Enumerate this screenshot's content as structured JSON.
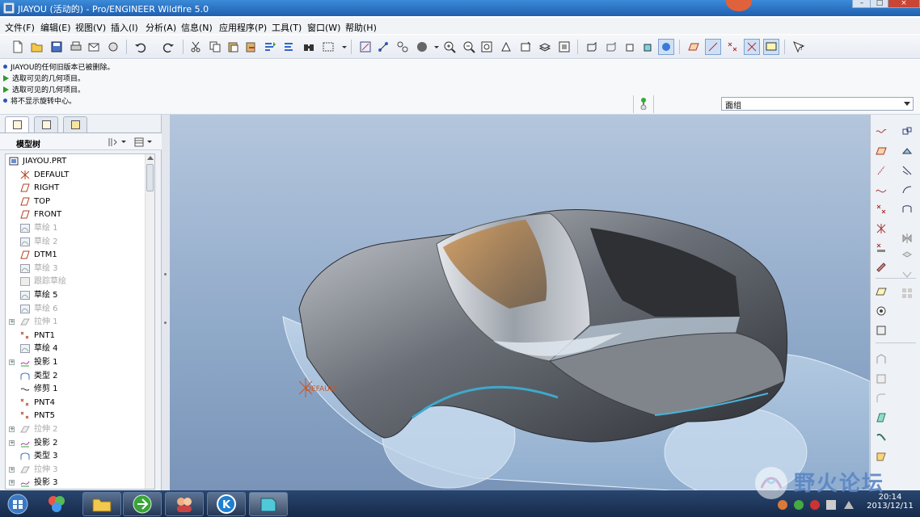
{
  "window": {
    "title": "JIAYOU (活动的) - Pro/ENGINEER Wildfire 5.0",
    "controls": [
      "–",
      "□",
      "×"
    ]
  },
  "menubar": {
    "items": [
      "文件(F)",
      "编辑(E)",
      "视图(V)",
      "插入(I)",
      "分析(A)",
      "信息(N)",
      "应用程序(P)",
      "工具(T)",
      "窗口(W)",
      "帮助(H)"
    ]
  },
  "messages": [
    {
      "kind": "info",
      "text": "JIAYOU的任何旧版本已被删除。"
    },
    {
      "kind": "prompt",
      "text": "选取可见的几何项目。"
    },
    {
      "kind": "prompt",
      "text": "选取可见的几何项目。"
    },
    {
      "kind": "info",
      "text": "将不显示旋转中心。"
    }
  ],
  "filter": {
    "value": "面组"
  },
  "model_tree": {
    "header": "模型树",
    "items": [
      {
        "label": "JIAYOU.PRT",
        "icon": "part-icon",
        "dim": false,
        "expander": false
      },
      {
        "label": "DEFAULT",
        "icon": "csys-icon",
        "dim": false,
        "expander": false
      },
      {
        "label": "RIGHT",
        "icon": "datum-plane-icon",
        "dim": false,
        "expander": false
      },
      {
        "label": "TOP",
        "icon": "datum-plane-icon",
        "dim": false,
        "expander": false
      },
      {
        "label": "FRONT",
        "icon": "datum-plane-icon",
        "dim": false,
        "expander": false
      },
      {
        "label": "草绘 1",
        "icon": "sketch-icon",
        "dim": true,
        "expander": false
      },
      {
        "label": "草绘 2",
        "icon": "sketch-icon",
        "dim": true,
        "expander": false
      },
      {
        "label": "DTM1",
        "icon": "datum-plane-icon",
        "dim": false,
        "expander": false
      },
      {
        "label": "草绘 3",
        "icon": "sketch-icon",
        "dim": true,
        "expander": false
      },
      {
        "label": "跟踪草绘",
        "icon": "trace-sketch-icon",
        "dim": true,
        "expander": false
      },
      {
        "label": "草绘 5",
        "icon": "sketch-icon",
        "dim": false,
        "expander": false
      },
      {
        "label": "草绘 6",
        "icon": "sketch-icon",
        "dim": true,
        "expander": false
      },
      {
        "label": "拉伸 1",
        "icon": "extrude-icon",
        "dim": true,
        "expander": true
      },
      {
        "label": "PNT1",
        "icon": "datum-point-icon",
        "dim": false,
        "expander": false
      },
      {
        "label": "草绘 4",
        "icon": "sketch-icon",
        "dim": false,
        "expander": false
      },
      {
        "label": "投影 1",
        "icon": "project-curve-icon",
        "dim": false,
        "expander": true
      },
      {
        "label": "类型 2",
        "icon": "boundary-blend-icon",
        "dim": false,
        "expander": false
      },
      {
        "label": "修剪 1",
        "icon": "trim-icon",
        "dim": false,
        "expander": false
      },
      {
        "label": "PNT4",
        "icon": "datum-point-icon",
        "dim": false,
        "expander": false
      },
      {
        "label": "PNT5",
        "icon": "datum-point-icon",
        "dim": false,
        "expander": false
      },
      {
        "label": "拉伸 2",
        "icon": "extrude-icon",
        "dim": true,
        "expander": true
      },
      {
        "label": "投影 2",
        "icon": "project-curve-icon",
        "dim": false,
        "expander": true
      },
      {
        "label": "类型 3",
        "icon": "boundary-blend-icon",
        "dim": false,
        "expander": false
      },
      {
        "label": "拉伸 3",
        "icon": "extrude-icon",
        "dim": true,
        "expander": true
      },
      {
        "label": "投影 3",
        "icon": "project-curve-icon",
        "dim": false,
        "expander": true
      }
    ]
  },
  "viewport": {
    "csys_label": "DEFAULT"
  },
  "taskbar": {
    "time": "20:14",
    "date": "2013/12/11"
  },
  "watermark": {
    "text": "野火论坛"
  },
  "colors": {
    "accent_blue": "#1f5fb0",
    "car_body": "#5d6168",
    "car_highlight": "#d9dce2",
    "glass_orange": "#c98a48",
    "ghost_surface": "#b9d3ea"
  }
}
